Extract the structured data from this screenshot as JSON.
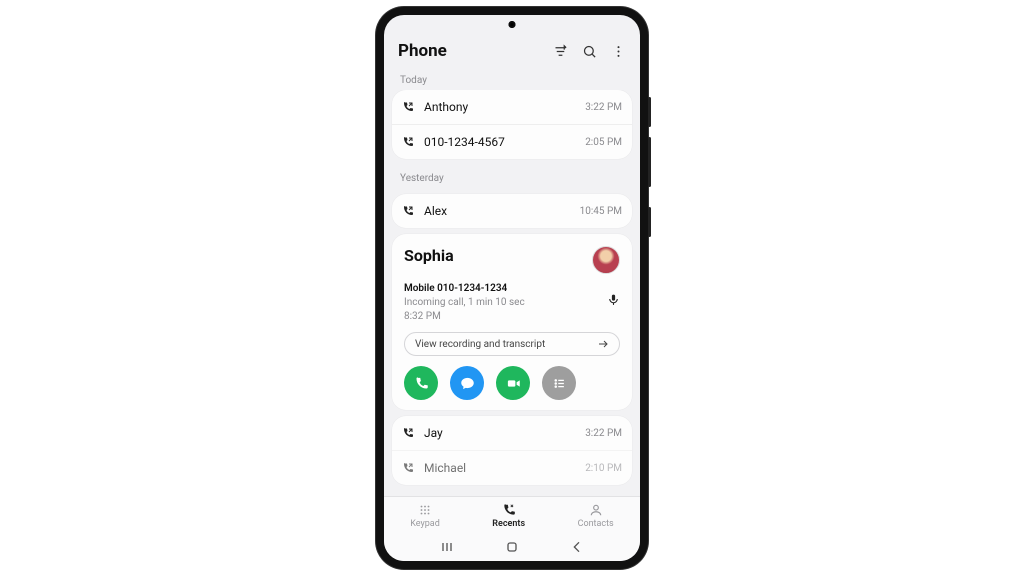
{
  "header": {
    "title": "Phone"
  },
  "sections": {
    "today": "Today",
    "yesterday": "Yesterday"
  },
  "calls": {
    "today": [
      {
        "name": "Anthony",
        "time": "3:22 PM",
        "dir": "outgoing"
      },
      {
        "name": "010-1234-4567",
        "time": "2:05 PM",
        "dir": "outgoing"
      }
    ],
    "yesterday_first": {
      "name": "Alex",
      "time": "10:45 PM",
      "dir": "outgoing"
    },
    "expanded": {
      "name": "Sophia",
      "phone_label": "Mobile 010-1234-1234",
      "detail": "Incoming call, 1 min 10 sec",
      "time": "8:32 PM",
      "pill": "View recording and transcript"
    },
    "rest": [
      {
        "name": "Jay",
        "time": "3:22 PM",
        "dir": "outgoing"
      },
      {
        "name": "Michael",
        "time": "2:10 PM",
        "dir": "outgoing"
      }
    ]
  },
  "tabs": {
    "keypad": "Keypad",
    "recents": "Recents",
    "contacts": "Contacts"
  }
}
